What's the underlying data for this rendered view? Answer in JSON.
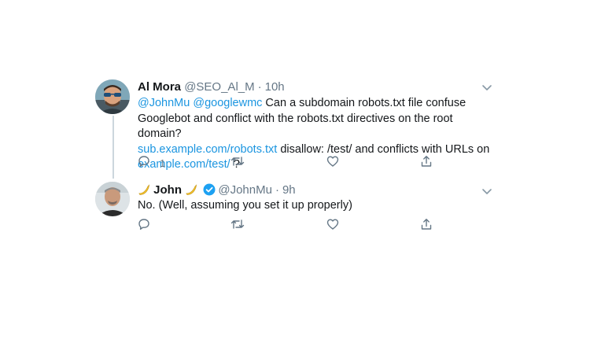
{
  "tweets": [
    {
      "name": "Al Mora",
      "handle": "@SEO_Al_M",
      "separator": "·",
      "time": "10h",
      "text": {
        "mention1": "@JohnMu",
        "mention2": "@googlewmc",
        "part1": " Can a subdomain robots.txt file confuse Googlebot and conflict with the robots.txt directives on the root domain?",
        "link1": "sub.example.com/robots.txt",
        "part2": " disallow: /test/ and conflicts with URLs on",
        "link2": "example.com/test/",
        "part3": " ?"
      },
      "reply_count": "1",
      "icons": [
        "reply-icon",
        "retweet-icon",
        "like-icon",
        "share-icon",
        "chevron-down-icon"
      ]
    },
    {
      "name": "John",
      "name_emoji": "🍌",
      "handle": "@JohnMu",
      "separator": "·",
      "time": "9h",
      "text": "No. (Well, assuming you set it up properly)",
      "verified": true,
      "icons": [
        "reply-icon",
        "retweet-icon",
        "like-icon",
        "share-icon",
        "chevron-down-icon"
      ]
    }
  ],
  "colors": {
    "link": "#1b95e0",
    "muted": "#657786",
    "verified": "#1da1f2",
    "thread_line": "#ccd6dd"
  }
}
